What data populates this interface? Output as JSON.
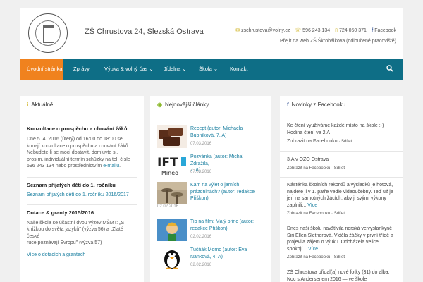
{
  "header": {
    "site_title": "ZŠ Chrustova 24, Slezská Ostrava",
    "email": "zschrustova@volny.cz",
    "phone1": "596 243 134",
    "phone2": "724 050 371",
    "facebook": "Facebook",
    "sublink": "Přejít na web ZŠ Škrobálkova (odloučené pracoviště)"
  },
  "nav": {
    "items": [
      {
        "label": "Úvodní stránka"
      },
      {
        "label": "Zprávy"
      },
      {
        "label": "Výuka & volný čas"
      },
      {
        "label": "Jídelna"
      },
      {
        "label": "Škola"
      },
      {
        "label": "Kontakt"
      }
    ],
    "arrow": "⌄"
  },
  "aktualne": {
    "title": "Aktuálně",
    "icon": "i",
    "n1_title": "Konzultace o prospěchu a chování žáků",
    "n1_l1": "Dne 5. 4. 2016 (úterý) od 16:00 do 18:00 se",
    "n1_l2": "konají konzultace o prospěchu a chování žáků.",
    "n1_l3": "Nebudete-li se moci dostavit, domluvte si,",
    "n1_l4": "prosím, individuální termín schůzky na tel. čísle",
    "n1_l5a": "596 243 134 nebo prostřednictvím",
    "n1_l5b": "e-mailu",
    "n2_title": "Seznam přijatých dětí do 1. ročníku",
    "n2_link": "Seznam přijatých dětí do 1. ročníku 2016/2017",
    "n3_title": "Dotace & granty 2015/2016",
    "n3_l1": "Naše škola se účastní dvou výzev MŠMT: „S",
    "n3_l2": "knížkou do světa jazyků\" (výzva 56) a „Zlaté české",
    "n3_l3": "ruce poznávají Evropu\" (výzva 57)",
    "n3_link": "Více o dotacích a grantech"
  },
  "clanky": {
    "title": "Nejnovější články",
    "items": [
      {
        "title1": "Recept (autor: Michaela",
        "title2": "Bubníková, 7. A)",
        "date": "07.03.2016"
      },
      {
        "title1": "Pozvánka (autor: Michal Zdražila,",
        "title2": "7. A)",
        "date": "07.03.2016"
      },
      {
        "title1": "Kam na výlet o jarních",
        "title2": "prázdninách? (autor: redakce",
        "title3": "Přiškon)",
        "date": "02.02.2016"
      },
      {
        "title1": "Tip na film: Malý princ (autor:",
        "title2": "redakce Přiškon)",
        "date": "02.02.2016"
      },
      {
        "title1": "Tučňák Momo (autor: Eva",
        "title2": "Nanková, 4. A)",
        "date": "02.02.2016"
      }
    ]
  },
  "facebook": {
    "title": "Novinky z Facebooku",
    "icon": "f",
    "zobrazit": "Zobrazit na Facebooku",
    "dot": "·",
    "sdilet": "Sdílet",
    "vice": "Více",
    "posts": [
      {
        "l1": "Ke čtení využíváme každé místo na škole :-)",
        "l2": "Hodina čtení ve 2.A"
      },
      {
        "l1": "3.A v OZO Ostrava"
      },
      {
        "l1": "Nástěnka školních rekordů a výsledků je hotová,",
        "l2": "najdete ji v 1. patře vedle videoučebny. Teď už je",
        "l3": "jen na samotných žácích, aby ji svými výkony",
        "l4": "zaplnili..."
      },
      {
        "l1": "Dnes naši školu navštívila norská velvyslankyně",
        "l2": "Siri Ellen Sletnerová. Viděla žáčky v první třídě a",
        "l3": "projevila zájem o výuku. Odcházela velice",
        "l4": "spokojí..."
      },
      {
        "l1": "ZŠ Chrustova přidal(a) nové fotky (31) do alba:",
        "l2": "Noc s Andersenem 2016 — ve škole"
      }
    ]
  },
  "colors": {
    "nav_bg": "#0e6e86",
    "nav_active": "#f0821e",
    "link": "#1a7fa0"
  }
}
